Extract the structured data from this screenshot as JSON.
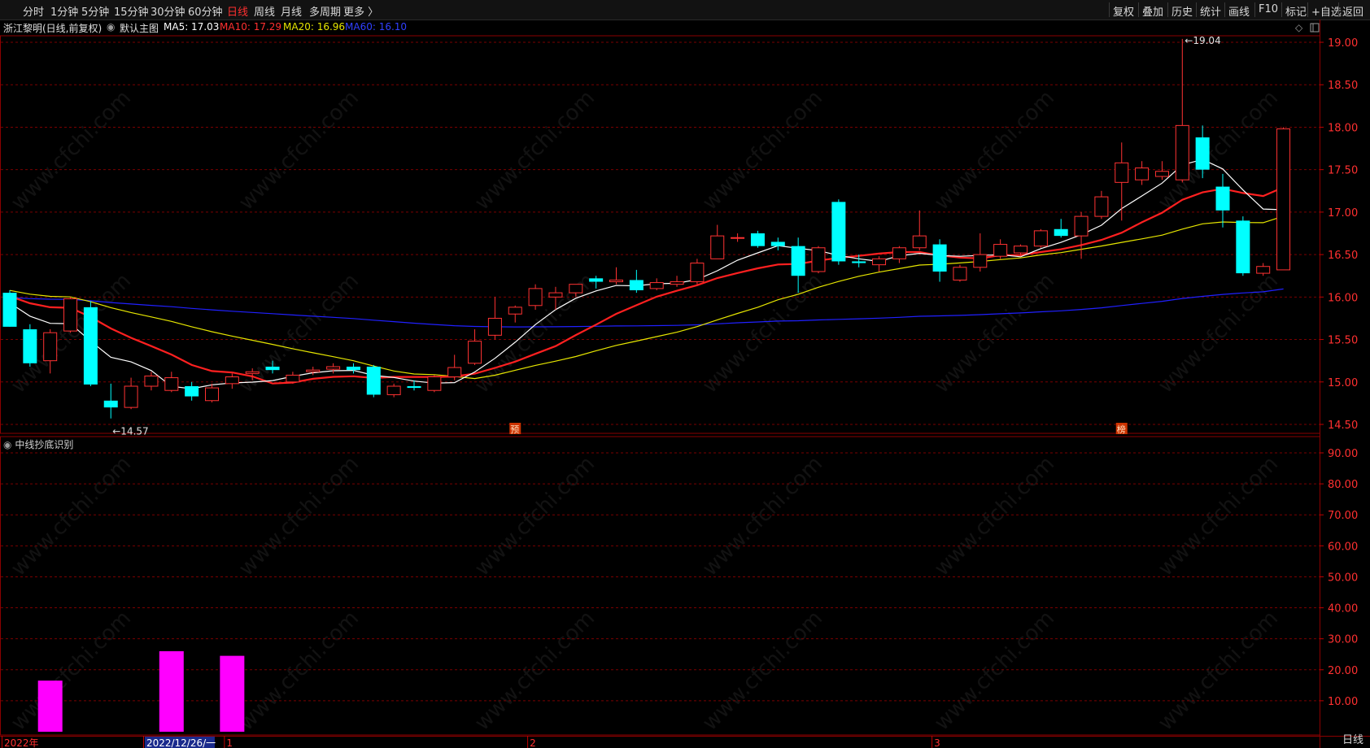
{
  "periods": [
    {
      "label": "分时",
      "active": false
    },
    {
      "label": "1分钟",
      "active": false
    },
    {
      "label": "5分钟",
      "active": false
    },
    {
      "label": "15分钟",
      "active": false
    },
    {
      "label": "30分钟",
      "active": false
    },
    {
      "label": "60分钟",
      "active": false
    },
    {
      "label": "日线",
      "active": true
    },
    {
      "label": "周线",
      "active": false
    },
    {
      "label": "月线",
      "active": false
    },
    {
      "label": "多周期",
      "active": false
    },
    {
      "label": "更多 〉",
      "active": false
    }
  ],
  "toolbar": [
    "复权",
    "叠加",
    "历史",
    "统计",
    "画线",
    "F10",
    "标记",
    "+自选",
    "返回"
  ],
  "info": {
    "stock": "浙江黎明(日线,前复权)",
    "main_label": "默认主图",
    "ma5": "MA5: 17.03",
    "ma10": "MA10: 17.29",
    "ma20": "MA20: 16.96",
    "ma60": "MA60: 16.10"
  },
  "colors": {
    "up": "#ff3232",
    "down": "#00ffff",
    "ma5": "#ffffff",
    "ma10": "#ff2020",
    "ma20": "#e6e600",
    "ma60": "#2020ff",
    "grid": "#7a0000",
    "indicator": "#ff00ff"
  },
  "indicator": {
    "name": "中线抄底识别"
  },
  "bottom_right_label": "日线",
  "watermark": "www.cfchi.com",
  "chart_data": {
    "type": "candlestick",
    "main": {
      "y_ticks": [
        "19.00",
        "18.50",
        "18.00",
        "17.50",
        "17.00",
        "16.50",
        "16.00",
        "15.50",
        "15.00",
        "14.50"
      ],
      "ylim": [
        14.5,
        19.0
      ],
      "annotations": [
        {
          "text": "19.04",
          "type": "high"
        },
        {
          "text": "14.57",
          "type": "low"
        }
      ],
      "markers": [
        {
          "text": "预",
          "index": 25
        },
        {
          "text": "榜",
          "index": 55
        }
      ],
      "candles": [
        {
          "o": 16.05,
          "h": 16.08,
          "l": 15.65,
          "c": 15.65
        },
        {
          "o": 15.62,
          "h": 15.68,
          "l": 15.18,
          "c": 15.22
        },
        {
          "o": 15.25,
          "h": 15.62,
          "l": 15.1,
          "c": 15.58
        },
        {
          "o": 15.6,
          "h": 16.0,
          "l": 15.58,
          "c": 15.98
        },
        {
          "o": 15.88,
          "h": 15.95,
          "l": 14.95,
          "c": 14.97
        },
        {
          "o": 14.78,
          "h": 14.98,
          "l": 14.57,
          "c": 14.7
        },
        {
          "o": 14.7,
          "h": 15.05,
          "l": 14.68,
          "c": 14.95
        },
        {
          "o": 14.95,
          "h": 15.12,
          "l": 14.9,
          "c": 15.07
        },
        {
          "o": 14.9,
          "h": 15.12,
          "l": 14.88,
          "c": 15.05
        },
        {
          "o": 14.95,
          "h": 15.0,
          "l": 14.78,
          "c": 14.83
        },
        {
          "o": 14.78,
          "h": 14.98,
          "l": 14.76,
          "c": 14.93
        },
        {
          "o": 14.98,
          "h": 15.1,
          "l": 14.92,
          "c": 15.06
        },
        {
          "o": 15.1,
          "h": 15.16,
          "l": 15.02,
          "c": 15.12
        },
        {
          "o": 15.18,
          "h": 15.25,
          "l": 15.1,
          "c": 15.14
        },
        {
          "o": 15.0,
          "h": 15.12,
          "l": 14.98,
          "c": 15.08
        },
        {
          "o": 15.12,
          "h": 15.18,
          "l": 15.08,
          "c": 15.14
        },
        {
          "o": 15.15,
          "h": 15.22,
          "l": 15.1,
          "c": 15.18
        },
        {
          "o": 15.18,
          "h": 15.22,
          "l": 15.1,
          "c": 15.14
        },
        {
          "o": 15.18,
          "h": 15.2,
          "l": 14.82,
          "c": 14.85
        },
        {
          "o": 14.85,
          "h": 14.98,
          "l": 14.82,
          "c": 14.95
        },
        {
          "o": 14.95,
          "h": 15.02,
          "l": 14.9,
          "c": 14.93
        },
        {
          "o": 14.9,
          "h": 15.08,
          "l": 14.88,
          "c": 15.06
        },
        {
          "o": 15.06,
          "h": 15.32,
          "l": 15.02,
          "c": 15.17
        },
        {
          "o": 15.22,
          "h": 15.62,
          "l": 15.2,
          "c": 15.48
        },
        {
          "o": 15.55,
          "h": 16.0,
          "l": 15.5,
          "c": 15.75
        },
        {
          "o": 15.8,
          "h": 15.9,
          "l": 15.7,
          "c": 15.88
        },
        {
          "o": 15.9,
          "h": 16.15,
          "l": 15.85,
          "c": 16.1
        },
        {
          "o": 16.0,
          "h": 16.12,
          "l": 15.85,
          "c": 16.05
        },
        {
          "o": 16.05,
          "h": 16.15,
          "l": 16.0,
          "c": 16.15
        },
        {
          "o": 16.22,
          "h": 16.25,
          "l": 16.1,
          "c": 16.18
        },
        {
          "o": 16.18,
          "h": 16.35,
          "l": 16.15,
          "c": 16.2
        },
        {
          "o": 16.2,
          "h": 16.32,
          "l": 16.05,
          "c": 16.08
        },
        {
          "o": 16.1,
          "h": 16.22,
          "l": 16.08,
          "c": 16.17
        },
        {
          "o": 16.15,
          "h": 16.25,
          "l": 16.12,
          "c": 16.18
        },
        {
          "o": 16.18,
          "h": 16.45,
          "l": 16.15,
          "c": 16.4
        },
        {
          "o": 16.45,
          "h": 16.85,
          "l": 16.45,
          "c": 16.72
        },
        {
          "o": 16.7,
          "h": 16.75,
          "l": 16.65,
          "c": 16.7
        },
        {
          "o": 16.75,
          "h": 16.78,
          "l": 16.58,
          "c": 16.6
        },
        {
          "o": 16.65,
          "h": 16.7,
          "l": 16.55,
          "c": 16.6
        },
        {
          "o": 16.6,
          "h": 16.7,
          "l": 16.05,
          "c": 16.25
        },
        {
          "o": 16.3,
          "h": 16.6,
          "l": 16.28,
          "c": 16.58
        },
        {
          "o": 17.12,
          "h": 17.15,
          "l": 16.38,
          "c": 16.42
        },
        {
          "o": 16.42,
          "h": 16.5,
          "l": 16.35,
          "c": 16.4
        },
        {
          "o": 16.38,
          "h": 16.48,
          "l": 16.3,
          "c": 16.45
        },
        {
          "o": 16.45,
          "h": 16.6,
          "l": 16.4,
          "c": 16.58
        },
        {
          "o": 16.58,
          "h": 17.02,
          "l": 16.55,
          "c": 16.72
        },
        {
          "o": 16.62,
          "h": 16.68,
          "l": 16.18,
          "c": 16.3
        },
        {
          "o": 16.2,
          "h": 16.38,
          "l": 16.18,
          "c": 16.35
        },
        {
          "o": 16.35,
          "h": 16.75,
          "l": 16.3,
          "c": 16.5
        },
        {
          "o": 16.48,
          "h": 16.68,
          "l": 16.45,
          "c": 16.62
        },
        {
          "o": 16.52,
          "h": 16.62,
          "l": 16.48,
          "c": 16.6
        },
        {
          "o": 16.6,
          "h": 16.8,
          "l": 16.58,
          "c": 16.78
        },
        {
          "o": 16.8,
          "h": 16.92,
          "l": 16.7,
          "c": 16.72
        },
        {
          "o": 16.72,
          "h": 17.0,
          "l": 16.45,
          "c": 16.95
        },
        {
          "o": 16.95,
          "h": 17.25,
          "l": 16.92,
          "c": 17.18
        },
        {
          "o": 17.35,
          "h": 17.82,
          "l": 16.9,
          "c": 17.58
        },
        {
          "o": 17.38,
          "h": 17.6,
          "l": 17.32,
          "c": 17.52
        },
        {
          "o": 17.42,
          "h": 17.6,
          "l": 17.38,
          "c": 17.48
        },
        {
          "o": 17.38,
          "h": 19.04,
          "l": 17.35,
          "c": 18.02
        },
        {
          "o": 17.88,
          "h": 18.02,
          "l": 17.4,
          "c": 17.5
        },
        {
          "o": 17.3,
          "h": 17.45,
          "l": 16.82,
          "c": 17.02
        },
        {
          "o": 16.9,
          "h": 16.95,
          "l": 16.25,
          "c": 16.28
        },
        {
          "o": 16.28,
          "h": 16.4,
          "l": 16.25,
          "c": 16.36
        },
        {
          "o": 16.32,
          "h": 18.0,
          "l": 16.32,
          "c": 17.98
        }
      ]
    },
    "indicator": {
      "name": "中线抄底识别",
      "y_ticks": [
        "90.00",
        "80.00",
        "70.00",
        "60.00",
        "50.00",
        "40.00",
        "30.00",
        "20.00",
        "10.00"
      ],
      "ylim": [
        0,
        96
      ],
      "bars": [
        {
          "index": 2,
          "value": 16.5
        },
        {
          "index": 8,
          "value": 26
        },
        {
          "index": 11,
          "value": 24.5
        }
      ]
    },
    "x_labels": [
      {
        "text": "2022年",
        "index": 0
      },
      {
        "text": "2022/12/26/一",
        "index": 7,
        "highlight": true
      },
      {
        "text": "1",
        "index": 11
      },
      {
        "text": "2",
        "index": 26
      },
      {
        "text": "3",
        "index": 46
      }
    ]
  }
}
